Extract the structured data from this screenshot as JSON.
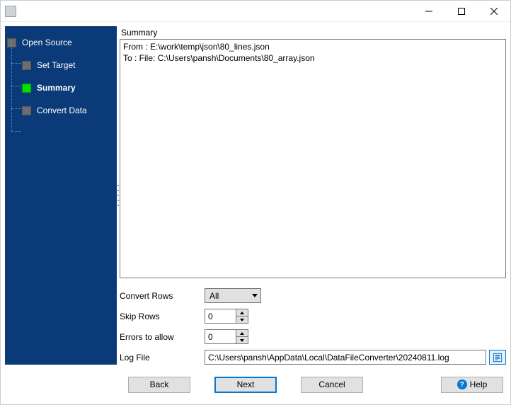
{
  "titlebar": {
    "title": ""
  },
  "sidebar": {
    "steps": [
      {
        "label": "Open Source"
      },
      {
        "label": "Set Target"
      },
      {
        "label": "Summary"
      },
      {
        "label": "Convert Data"
      }
    ]
  },
  "summary": {
    "heading": "Summary",
    "from_line": "From : E:\\work\\temp\\json\\80_lines.json",
    "to_line": "To : File: C:\\Users\\pansh\\Documents\\80_array.json"
  },
  "options": {
    "convert_rows_label": "Convert Rows",
    "convert_rows_value": "All",
    "skip_rows_label": "Skip Rows",
    "skip_rows_value": "0",
    "errors_label": "Errors to allow",
    "errors_value": "0",
    "logfile_label": "Log File",
    "logfile_value": "C:\\Users\\pansh\\AppData\\Local\\DataFileConverter\\20240811.log"
  },
  "footer": {
    "back": "Back",
    "next": "Next",
    "cancel": "Cancel",
    "help": "Help"
  }
}
